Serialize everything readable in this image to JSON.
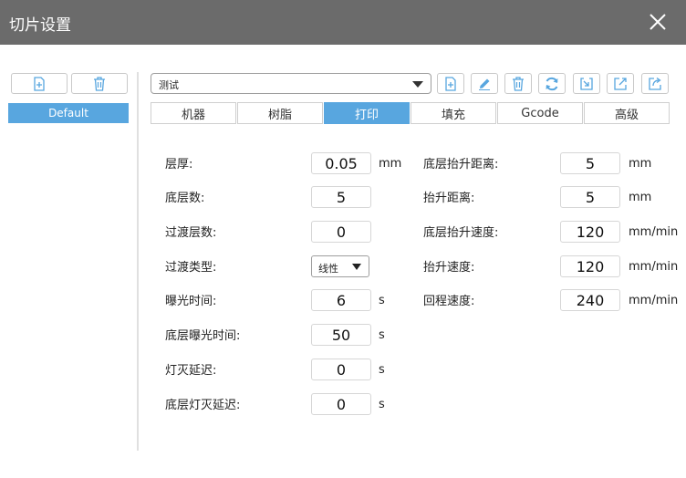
{
  "window": {
    "title": "切片设置"
  },
  "profiles": {
    "items": [
      "Default"
    ]
  },
  "profile_select": {
    "value": "测试"
  },
  "tabs": [
    "机器",
    "树脂",
    "打印",
    "填充",
    "Gcode",
    "高级"
  ],
  "active_tab": "打印",
  "left_params": [
    {
      "label": "层厚:",
      "value": "0.05",
      "unit": "mm"
    },
    {
      "label": "底层数:",
      "value": "5",
      "unit": ""
    },
    {
      "label": "过渡层数:",
      "value": "0",
      "unit": ""
    },
    {
      "label": "过渡类型:",
      "value": "线性",
      "unit": ""
    },
    {
      "label": "曝光时间:",
      "value": "6",
      "unit": "s"
    },
    {
      "label": "底层曝光时间:",
      "value": "50",
      "unit": "s"
    },
    {
      "label": "灯灭延迟:",
      "value": "0",
      "unit": "s"
    },
    {
      "label": "底层灯灭延迟:",
      "value": "0",
      "unit": "s"
    }
  ],
  "right_params": [
    {
      "label": "底层抬升距离:",
      "value": "5",
      "unit": "mm"
    },
    {
      "label": "抬升距离:",
      "value": "5",
      "unit": "mm"
    },
    {
      "label": "底层抬升速度:",
      "value": "120",
      "unit": "mm/min"
    },
    {
      "label": "抬升速度:",
      "value": "120",
      "unit": "mm/min"
    },
    {
      "label": "回程速度:",
      "value": "240",
      "unit": "mm/min"
    }
  ],
  "icons": {
    "close": "close-icon",
    "profile_add": "new-file-icon",
    "profile_delete": "trash-icon",
    "toolbar": [
      "new-file-icon",
      "edit-pencil-icon",
      "trash-icon",
      "refresh-icon",
      "import-icon",
      "export-icon",
      "share-icon"
    ]
  },
  "colors": {
    "titlebar": "#6b6b6b",
    "accent": "#58a6df",
    "icon": "#58a6df"
  }
}
